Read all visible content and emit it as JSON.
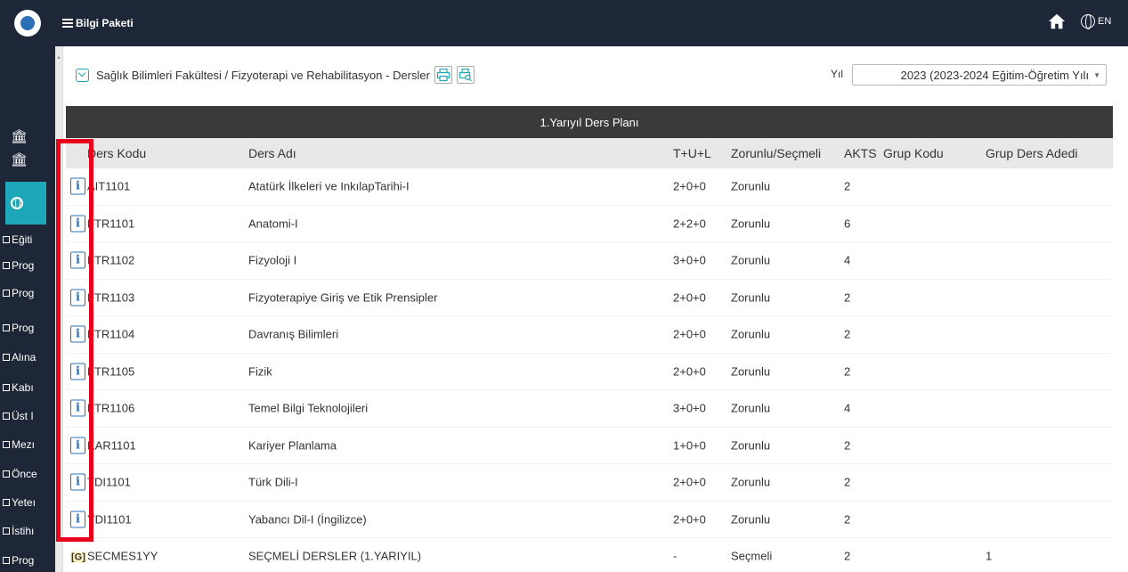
{
  "header": {
    "menu_label": "Bilgi Paketi",
    "lang_label": "EN"
  },
  "sidebar": {
    "items": [
      {
        "label": "Eğiti"
      },
      {
        "label": "Prog"
      },
      {
        "label": "Prog"
      },
      {
        "label": "Prog"
      },
      {
        "label": "Alına"
      },
      {
        "label": "Kabı"
      },
      {
        "label": "Üst I"
      },
      {
        "label": "Mezı"
      },
      {
        "label": "Önce"
      },
      {
        "label": "Yeteı"
      },
      {
        "label": "İstihı"
      },
      {
        "label": "Prog"
      }
    ]
  },
  "breadcrumb": {
    "text": "Sağlık Bilimleri Fakültesi / Fizyoterapi ve Rehabilitasyon - Dersler"
  },
  "year": {
    "label": "Yıl",
    "selected": "2023 (2023-2024 Eğitim-Öğretim Yılı"
  },
  "table": {
    "semester_title": "1.Yarıyıl Ders Planı",
    "headers": {
      "code": "Ders Kodu",
      "name": "Ders Adı",
      "tul": "T+U+L",
      "type": "Zorunlu/Seçmeli",
      "akts": "AKTS",
      "group_code": "Grup Kodu",
      "group_count": "Grup Ders Adedi"
    },
    "rows": [
      {
        "info": "i",
        "code": "AIT1101",
        "name": "Atatürk İlkeleri ve InkılapTarihi-I",
        "tul": "2+0+0",
        "type": "Zorunlu",
        "akts": "2",
        "group_count": ""
      },
      {
        "info": "i",
        "code": "FTR1101",
        "name": "Anatomi-I",
        "tul": "2+2+0",
        "type": "Zorunlu",
        "akts": "6",
        "group_count": ""
      },
      {
        "info": "i",
        "code": "FTR1102",
        "name": "Fizyoloji I",
        "tul": "3+0+0",
        "type": "Zorunlu",
        "akts": "4",
        "group_count": ""
      },
      {
        "info": "i",
        "code": "FTR1103",
        "name": "Fizyoterapiye Giriş ve Etik Prensipler",
        "tul": "2+0+0",
        "type": "Zorunlu",
        "akts": "2",
        "group_count": ""
      },
      {
        "info": "i",
        "code": "FTR1104",
        "name": "Davranış Bilimleri",
        "tul": "2+0+0",
        "type": "Zorunlu",
        "akts": "2",
        "group_count": ""
      },
      {
        "info": "i",
        "code": "FTR1105",
        "name": "Fizik",
        "tul": "2+0+0",
        "type": "Zorunlu",
        "akts": "2",
        "group_count": ""
      },
      {
        "info": "i",
        "code": "FTR1106",
        "name": "Temel Bilgi Teknolojileri",
        "tul": "3+0+0",
        "type": "Zorunlu",
        "akts": "4",
        "group_count": ""
      },
      {
        "info": "i",
        "code": "KAR1101",
        "name": "Kariyer Planlama",
        "tul": "1+0+0",
        "type": "Zorunlu",
        "akts": "2",
        "group_count": ""
      },
      {
        "info": "i",
        "code": "TDI1101",
        "name": "Türk Dili-I",
        "tul": "2+0+0",
        "type": "Zorunlu",
        "akts": "2",
        "group_count": ""
      },
      {
        "info": "i",
        "code": "YDI1101",
        "name": "Yabancı Dil-I (İngilizce)",
        "tul": "2+0+0",
        "type": "Zorunlu",
        "akts": "2",
        "group_count": ""
      },
      {
        "info": "[G]",
        "code": "SECMES1YY",
        "name": "SEÇMELİ DERSLER (1.YARIYIL)",
        "tul": "-",
        "type": "Seçmeli",
        "akts": "2",
        "group_count": "1"
      }
    ]
  },
  "colors": {
    "navy": "#1e2738",
    "teal": "#1ea7b8",
    "highlight": "#e8001c"
  }
}
